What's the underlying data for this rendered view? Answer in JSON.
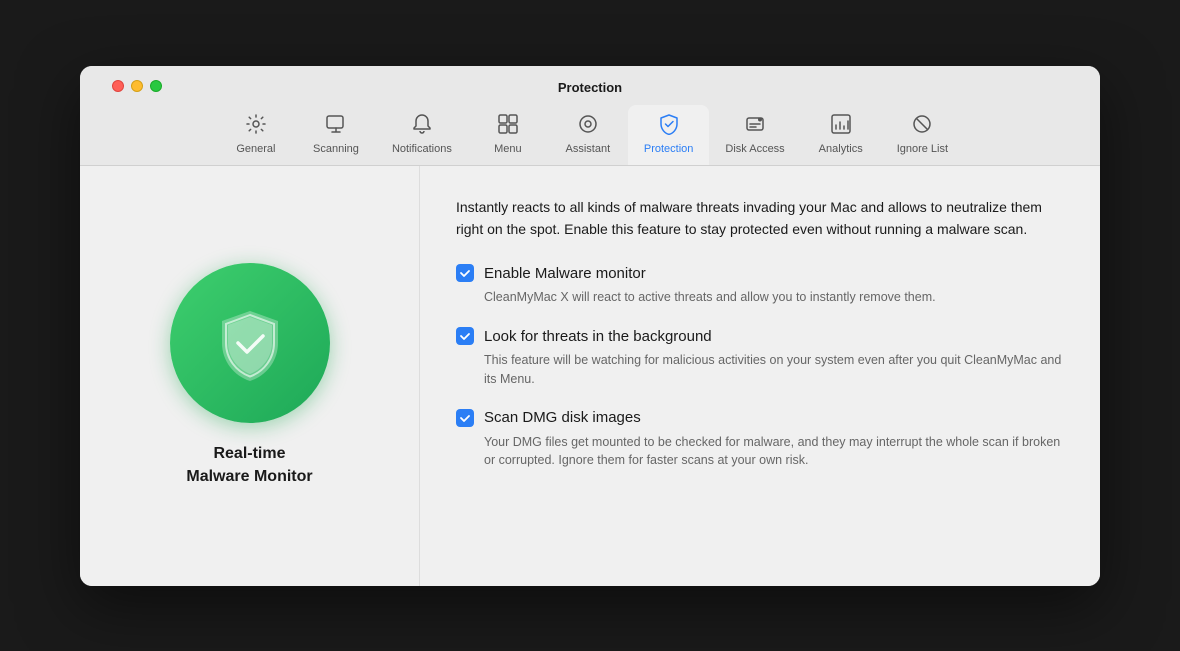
{
  "window": {
    "title": "Protection"
  },
  "toolbar": {
    "tabs": [
      {
        "id": "general",
        "label": "General",
        "icon": "⚙️",
        "active": false
      },
      {
        "id": "scanning",
        "label": "Scanning",
        "icon": "🖥",
        "active": false
      },
      {
        "id": "notifications",
        "label": "Notifications",
        "icon": "🔔",
        "active": false
      },
      {
        "id": "menu",
        "label": "Menu",
        "icon": "▦",
        "active": false
      },
      {
        "id": "assistant",
        "label": "Assistant",
        "icon": "◉",
        "active": false
      },
      {
        "id": "protection",
        "label": "Protection",
        "icon": "🛡",
        "active": true
      },
      {
        "id": "disk-access",
        "label": "Disk Access",
        "icon": "💾",
        "active": false
      },
      {
        "id": "analytics",
        "label": "Analytics",
        "icon": "📊",
        "active": false
      },
      {
        "id": "ignore-list",
        "label": "Ignore List",
        "icon": "⊘",
        "active": false
      }
    ]
  },
  "sidebar": {
    "title": "Real-time\nMalware Monitor"
  },
  "main": {
    "description": "Instantly reacts to all kinds of malware threats invading your Mac and allows to neutralize them right on the spot. Enable this feature to stay protected even without running a malware scan.",
    "options": [
      {
        "id": "enable-malware",
        "title": "Enable Malware monitor",
        "description": "CleanMyMac X will react to active threats and allow you to instantly remove them.",
        "checked": true
      },
      {
        "id": "background-threats",
        "title": "Look for threats in the background",
        "description": "This feature will be watching for malicious activities on your system even after you quit CleanMyMac and its Menu.",
        "checked": true
      },
      {
        "id": "scan-dmg",
        "title": "Scan DMG disk images",
        "description": "Your DMG files get mounted to be checked for malware, and they may interrupt the whole scan if broken or corrupted. Ignore them for faster scans at your own risk.",
        "checked": true
      }
    ]
  },
  "colors": {
    "accent": "#2b7ef5",
    "green_gradient_start": "#3ecf6e",
    "green_gradient_end": "#1da857"
  }
}
